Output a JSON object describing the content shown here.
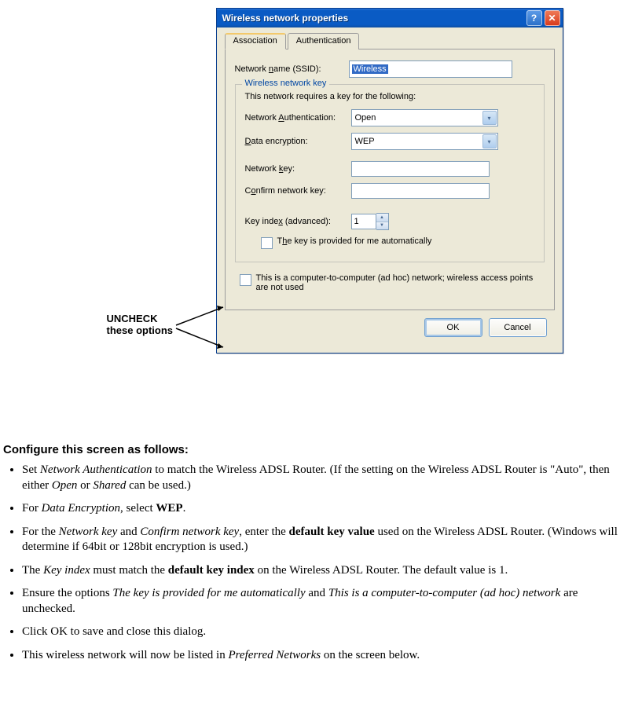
{
  "dialog": {
    "title": "Wireless network properties",
    "tabs": {
      "association": "Association",
      "authentication": "Authentication"
    },
    "ssid_label_pre": "Network ",
    "ssid_label_key": "n",
    "ssid_label_post": "ame (SSID):",
    "ssid_value": "Wireless",
    "groupbox_title": "Wireless network key",
    "groupbox_subtitle": "This network requires a key for the following:",
    "auth_label_pre": "Network ",
    "auth_label_key": "A",
    "auth_label_post": "uthentication:",
    "auth_value": "Open",
    "enc_label_key": "D",
    "enc_label_post": "ata encryption:",
    "enc_value": "WEP",
    "key_label_pre": "Network ",
    "key_label_key": "k",
    "key_label_post": "ey:",
    "confirm_label_pre": "C",
    "confirm_label_key": "o",
    "confirm_label_post": "nfirm network key:",
    "index_label_pre": "Key inde",
    "index_label_key": "x",
    "index_label_post": " (advanced):",
    "index_value": "1",
    "check_auto_pre": "T",
    "check_auto_key": "h",
    "check_auto_post": "e key is provided for me automatically",
    "check_adhoc": "This is a computer-to-computer (ad hoc) network; wireless access points are not used",
    "ok": "OK",
    "cancel": "Cancel"
  },
  "annotation": {
    "line1": "UNCHECK",
    "line2": "these options"
  },
  "doc": {
    "heading": "Configure this screen as follows:",
    "b1_a": "Set ",
    "b1_i1": "Network Authentication",
    "b1_b": " to match the Wireless ADSL Router. (If the setting on the Wireless ADSL Router is \"Auto\", then either ",
    "b1_i2": "Open",
    "b1_c": " or ",
    "b1_i3": "Shared",
    "b1_d": " can be used.)",
    "b2_a": "For ",
    "b2_i1": "Data Encryption",
    "b2_b": ", select ",
    "b2_s": "WEP",
    "b2_c": ".",
    "b3_a": "For the ",
    "b3_i1": "Network key",
    "b3_b": " and ",
    "b3_i2": "Confirm network key",
    "b3_c": ", enter the ",
    "b3_s": "default key value",
    "b3_d": " used on the Wireless ADSL Router. (Windows will determine if 64bit or 128bit encryption is used.)",
    "b4_a": "The ",
    "b4_i1": "Key index",
    "b4_b": " must match the ",
    "b4_s": "default key index",
    "b4_c": " on the Wireless ADSL Router. The default value is 1.",
    "b5_a": "Ensure the options ",
    "b5_i1": "The key is provided for me automatically",
    "b5_b": " and ",
    "b5_i2": "This is a computer-to-computer (ad hoc) network",
    "b5_c": " are unchecked.",
    "b6": "Click OK to save and close this dialog.",
    "b7_a": "This wireless network will now be listed in ",
    "b7_i1": "Preferred Networks",
    "b7_b": " on the screen below."
  }
}
